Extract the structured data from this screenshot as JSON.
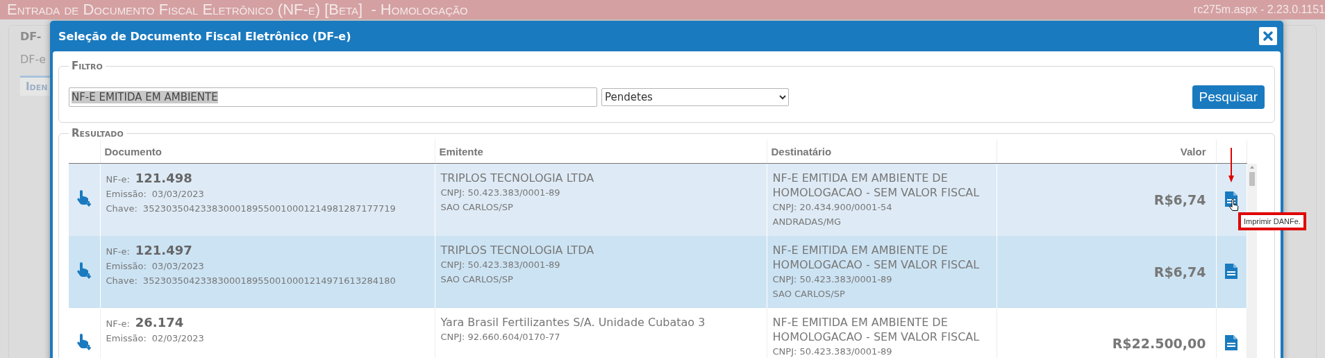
{
  "app_bar": {
    "title": "Entrada de Documento Fiscal Eletrônico (NF-e) [Beta]  - Homologação",
    "version": "rc275m.aspx - 2.23.0.1151"
  },
  "background_page": {
    "legend": "DF-",
    "label": "DF-e",
    "tab": "Iden"
  },
  "dialog": {
    "title": "Seleção de Documento Fiscal Eletrônico (DF-e)",
    "filter": {
      "legend": "Filtro",
      "search": {
        "value": "NF-E EMITIDA EM AMBIENTE",
        "text_selected": true
      },
      "status": {
        "value": "Pendetes"
      },
      "button": "Pesquisar"
    },
    "result": {
      "legend": "Resultado",
      "columns": [
        "Documento",
        "Emitente",
        "Destinatário",
        "Valor"
      ],
      "rows": [
        {
          "hovered": true,
          "selected": false,
          "doc_label": "NF-e:",
          "number": "121.498",
          "emission_label": "Emissão:",
          "emission": "03/03/2023",
          "key_label": "Chave:",
          "key": "35230350423383000189550010001214981287177719",
          "issuer": "TRIPLOS TECNOLOGIA LTDA",
          "issuer_cnpj": "CNPJ: 50.423.383/0001-89",
          "issuer_city": "SAO CARLOS/SP",
          "recipient": "NF-E EMITIDA EM AMBIENTE DE HOMOLOGACAO - SEM VALOR FISCAL",
          "recipient_cnpj": "CNPJ: 20.434.900/0001-54",
          "recipient_city": "ANDRADAS/MG",
          "value": "R$6,74",
          "tooltip": {
            "text": "Imprimir DANFe.",
            "highlighted": true
          }
        },
        {
          "hovered": false,
          "selected": true,
          "doc_label": "NF-e:",
          "number": "121.497",
          "emission_label": "Emissão:",
          "emission": "03/03/2023",
          "key_label": "Chave:",
          "key": "35230350423383000189550010001214971613284180",
          "issuer": "TRIPLOS TECNOLOGIA LTDA",
          "issuer_cnpj": "CNPJ: 50.423.383/0001-89",
          "issuer_city": "SAO CARLOS/SP",
          "recipient": "NF-E EMITIDA EM AMBIENTE DE HOMOLOGACAO - SEM VALOR FISCAL",
          "recipient_cnpj": "CNPJ: 50.423.383/0001-89",
          "recipient_city": "SAO CARLOS/SP",
          "value": "R$6,74"
        },
        {
          "hovered": false,
          "selected": false,
          "doc_label": "NF-e:",
          "number": "26.174",
          "emission_label": "Emissão:",
          "emission": "02/03/2023",
          "issuer": "Yara Brasil Fertilizantes S/A. Unidade Cubatao 3",
          "issuer_cnpj": "CNPJ: 92.660.604/0170-77",
          "recipient": "NF-E EMITIDA EM AMBIENTE DE HOMOLOGACAO - SEM VALOR FISCAL",
          "recipient_cnpj": "CNPJ: 50.423.383/0001-89",
          "value": "R$22.500,00"
        }
      ]
    }
  }
}
